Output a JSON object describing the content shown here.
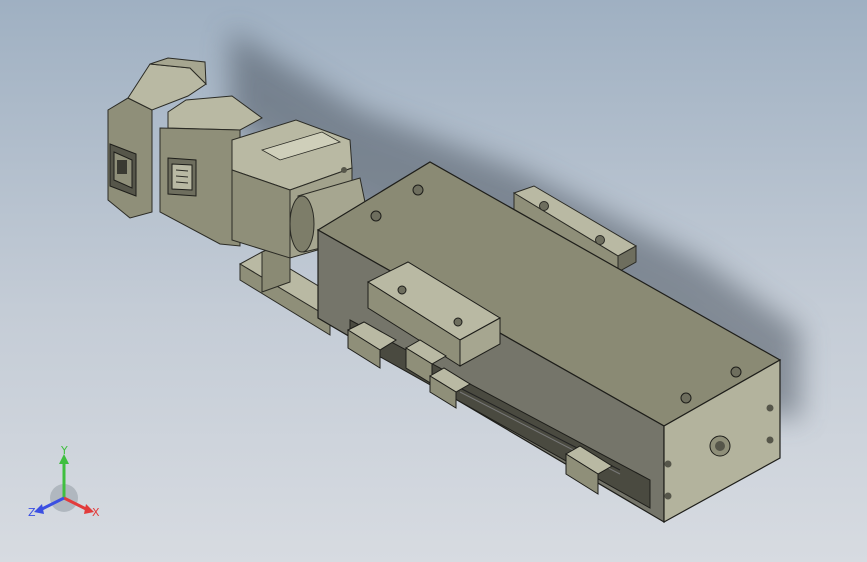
{
  "viewport": {
    "background_top": "#9fb0c2",
    "background_bottom": "#d7dbe1"
  },
  "model": {
    "body_color": "#8f8f79",
    "body_light": "#b9b9a3",
    "body_dark": "#56564a",
    "parts": [
      "servo-motor",
      "motor-connector",
      "motor-flange",
      "coupling-housing",
      "actuator-body",
      "carriage",
      "end-cap",
      "base-bracket",
      "limit-sensors"
    ]
  },
  "triad": {
    "x_label": "X",
    "y_label": "Y",
    "z_label": "Z",
    "x_color": "#e23b3b",
    "y_color": "#3fbf3f",
    "z_color": "#3b4fe2"
  }
}
